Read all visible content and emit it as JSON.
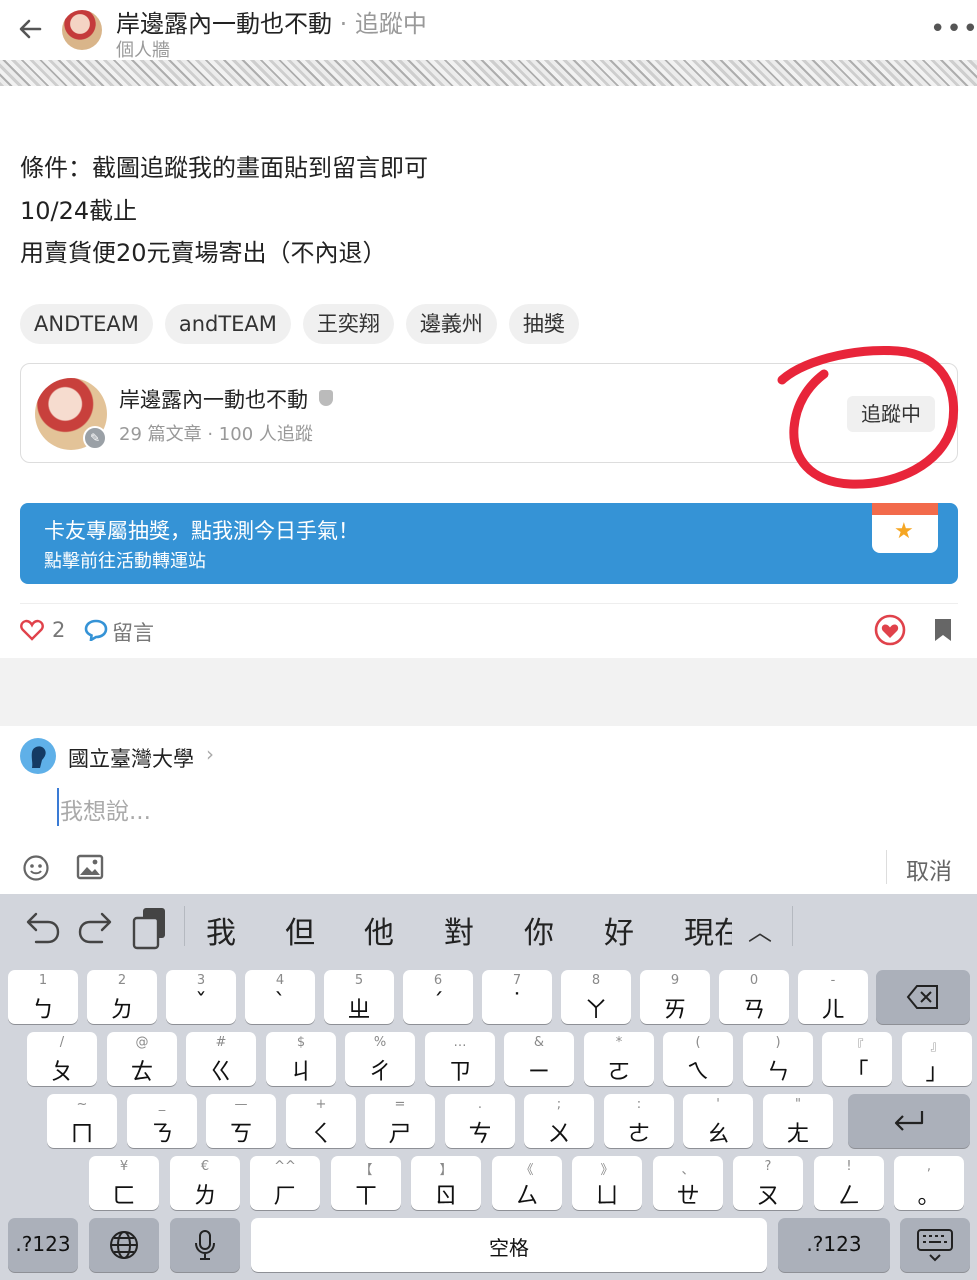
{
  "header": {
    "title": "岸邊露內一動也不動",
    "follow_status": "追蹤中",
    "separator": " · ",
    "subtitle": "個人牆",
    "more": "•••"
  },
  "post": {
    "lines": [
      "條件：截圖追蹤我的畫面貼到留言即可",
      "10/24截止",
      "用賣貨便20元賣場寄出（不內退）"
    ],
    "tags": [
      "ANDTEAM",
      "andTEAM",
      "王奕翔",
      "邊義州",
      "抽獎"
    ]
  },
  "author_card": {
    "name": "岸邊露內一動也不動",
    "stats": "29 篇文章 · 100 人追蹤",
    "follow_button": "追蹤中"
  },
  "promo": {
    "line1": "卡友專屬抽獎，點我測今日手氣！",
    "line2": "點擊前往活動轉運站",
    "icon": "calendar-star-icon"
  },
  "actions": {
    "like_count": "2",
    "comment_label": "留言"
  },
  "composer": {
    "school": "國立臺灣大學",
    "chevron": "›",
    "placeholder": "我想說...",
    "cancel": "取消"
  },
  "keyboard": {
    "candidates": [
      "我",
      "但",
      "他",
      "對",
      "你",
      "好",
      "現在"
    ],
    "collapse_glyph": "︿",
    "row1": [
      {
        "sup": "1",
        "main": "ㄅ"
      },
      {
        "sup": "2",
        "main": "ㄉ"
      },
      {
        "sup": "3",
        "main": "ˇ"
      },
      {
        "sup": "4",
        "main": "ˋ"
      },
      {
        "sup": "5",
        "main": "ㄓ"
      },
      {
        "sup": "6",
        "main": "ˊ"
      },
      {
        "sup": "7",
        "main": "˙"
      },
      {
        "sup": "8",
        "main": "ㄚ"
      },
      {
        "sup": "9",
        "main": "ㄞ"
      },
      {
        "sup": "0",
        "main": "ㄢ"
      },
      {
        "sup": "-",
        "main": "ㄦ"
      }
    ],
    "row2": [
      {
        "sup": "/",
        "main": "ㄆ"
      },
      {
        "sup": "@",
        "main": "ㄊ"
      },
      {
        "sup": "#",
        "main": "ㄍ"
      },
      {
        "sup": "$",
        "main": "ㄐ"
      },
      {
        "sup": "%",
        "main": "ㄔ"
      },
      {
        "sup": "…",
        "main": "ㄗ"
      },
      {
        "sup": "&",
        "main": "ㄧ"
      },
      {
        "sup": "*",
        "main": "ㄛ"
      },
      {
        "sup": "(",
        "main": "ㄟ"
      },
      {
        "sup": ")",
        "main": "ㄣ"
      },
      {
        "sup": "『",
        "main": "「"
      },
      {
        "sup": "』",
        "main": "」"
      }
    ],
    "row3": [
      {
        "sup": "~",
        "main": "ㄇ"
      },
      {
        "sup": "_",
        "main": "ㄋ"
      },
      {
        "sup": "—",
        "main": "ㄎ"
      },
      {
        "sup": "+",
        "main": "ㄑ"
      },
      {
        "sup": "=",
        "main": "ㄕ"
      },
      {
        "sup": ".",
        "main": "ㄘ"
      },
      {
        "sup": ";",
        "main": "ㄨ"
      },
      {
        "sup": ":",
        "main": "ㄜ"
      },
      {
        "sup": "'",
        "main": "ㄠ"
      },
      {
        "sup": "\"",
        "main": "ㄤ"
      }
    ],
    "row4": [
      {
        "sup": "¥",
        "main": "ㄈ"
      },
      {
        "sup": "€",
        "main": "ㄌ"
      },
      {
        "sup": "^^",
        "main": "ㄏ"
      },
      {
        "sup": "【",
        "main": "ㄒ"
      },
      {
        "sup": "】",
        "main": "ㄖ"
      },
      {
        "sup": "《",
        "main": "ㄙ"
      },
      {
        "sup": "》",
        "main": "ㄩ"
      },
      {
        "sup": "、",
        "main": "ㄝ"
      },
      {
        "sup": "?",
        "main": "ㄡ"
      },
      {
        "sup": "!",
        "main": "ㄥ"
      },
      {
        "sup": ",",
        "main": "。"
      }
    ],
    "num_key": ".?123",
    "space_key": "空格"
  },
  "colors": {
    "accent_blue": "#3593d6",
    "like_red": "#e0424b",
    "annotation_red": "#e8253a",
    "keyboard_bg": "#d2d5dc"
  }
}
